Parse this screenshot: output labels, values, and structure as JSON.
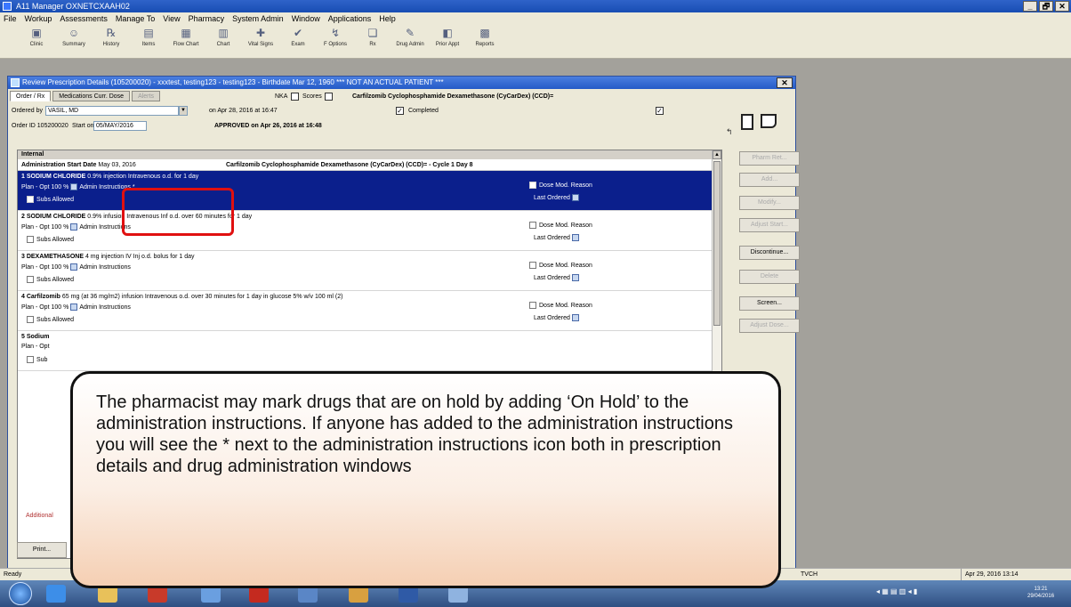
{
  "app": {
    "title": "A11 Manager OXNETCXAAH02",
    "controls": [
      "_",
      "🗗",
      "✕"
    ]
  },
  "menu": [
    "File",
    "Workup",
    "Assessments",
    "Manage To",
    "View",
    "Pharmacy",
    "System Admin",
    "Window",
    "Applications",
    "Help"
  ],
  "toolbar": [
    {
      "label": "Clinic",
      "icon": "clinic-icon",
      "glyph": "▣"
    },
    {
      "label": "Summary",
      "icon": "summary-icon",
      "glyph": "☺"
    },
    {
      "label": "History",
      "icon": "history-icon",
      "glyph": "℞"
    },
    {
      "label": "Items",
      "icon": "items-icon",
      "glyph": "▤"
    },
    {
      "label": "Flow Chart",
      "icon": "flow-chart-icon",
      "glyph": "▦"
    },
    {
      "label": "Chart",
      "icon": "chart-icon",
      "glyph": "▥"
    },
    {
      "label": "Vital Signs",
      "icon": "vital-signs-icon",
      "glyph": "✚"
    },
    {
      "label": "Exam",
      "icon": "exam-icon",
      "glyph": "✔"
    },
    {
      "label": "F Options",
      "icon": "options-icon",
      "glyph": "↯"
    },
    {
      "label": "Rx",
      "icon": "rx-icon",
      "glyph": "❏"
    },
    {
      "label": "Drug Admin",
      "icon": "drug-admin-icon",
      "glyph": "✎"
    },
    {
      "label": "Prior Appt",
      "icon": "prior-appt-icon",
      "glyph": "◧"
    },
    {
      "label": "Reports",
      "icon": "reports-icon",
      "glyph": "▩"
    }
  ],
  "child": {
    "title": "Review Prescription Details (105200020) - xxxtest, testing123 - testing123 - Birthdate Mar 12, 1960 *** NOT AN ACTUAL PATIENT ***",
    "close": "✕",
    "tabs": [
      "Order / Rx",
      "Medications Curr. Dose",
      "Alerts"
    ],
    "nka": "NKA",
    "scores": "Scores",
    "regimen_title": "Carfilzomib Cyclophosphamide Dexamethasone (CyCarDex) (CCD)=",
    "ordered_by_label": "Ordered by",
    "ordered_by_value": "VASIL, MD",
    "ordered_on": "on Apr 28, 2016  at 16:47",
    "completed_label": "Completed",
    "order_id_label": "Order ID 105200020",
    "start_on_label": "Start on",
    "start_on_value": "05/MAY/2016",
    "approved": "APPROVED on Apr 26, 2016 at 16:48",
    "section": "Internal",
    "admin_start_label": "Administration Start Date",
    "admin_start_value": "May 03, 2016",
    "protocol_line": "Carfilzomib Cyclophosphamide Dexamethasone (CyCarDex) (CCD)= - Cycle 1 Day 8"
  },
  "drugs": [
    {
      "name": "1  SODIUM CHLORIDE",
      "detail": "0.9% injection Intravenous o.d. for 1 day",
      "plan": "Plan - Opt   100 %",
      "admin": "Admin Instructions",
      "admin_star": "*",
      "subs": "Subs Allowed",
      "dose_mod": "Dose Mod. Reason",
      "last_ordered": "Last Ordered"
    },
    {
      "name": "2  SODIUM CHLORIDE",
      "detail": "0.9% infusion Intravenous Inf o.d. over 60 minutes for 1 day",
      "plan": "Plan - Opt   100 %",
      "admin": "Admin Instructions",
      "subs": "Subs Allowed",
      "dose_mod": "Dose Mod. Reason",
      "last_ordered": "Last Ordered"
    },
    {
      "name": "3  DEXAMETHASONE",
      "detail": "4 mg injection IV Inj o.d. bolus for 1 day",
      "plan": "Plan - Opt   100 %",
      "admin": "Admin Instructions",
      "subs": "Subs Allowed",
      "dose_mod": "Dose Mod. Reason",
      "last_ordered": "Last Ordered"
    },
    {
      "name": "4  Carfilzomib",
      "detail": "65 mg (at 36 mg/m2) infusion Intravenous o.d. over 30 minutes for 1 day in glucose 5% w/v 100 ml (2)",
      "plan": "Plan - Opt   100 %",
      "admin": "Admin Instructions",
      "subs": "Subs Allowed",
      "dose_mod": "Dose Mod. Reason",
      "last_ordered": "Last Ordered"
    },
    {
      "name": "5  Sodium",
      "detail": "",
      "plan": "Plan - Opt",
      "admin": "",
      "subs": "Sub",
      "dose_mod": "",
      "last_ordered": ""
    }
  ],
  "side_buttons": [
    {
      "label": "Pharm Ret...",
      "enabled": false
    },
    {
      "label": "Add...",
      "enabled": false
    },
    {
      "label": "Modify...",
      "enabled": false
    },
    {
      "label": "Adjust Start...",
      "enabled": false
    },
    {
      "label": "Discontinue...",
      "enabled": true
    },
    {
      "label": "Delete",
      "enabled": false
    },
    {
      "label": "Screen...",
      "enabled": true
    },
    {
      "label": "Adjust Dose...",
      "enabled": false
    }
  ],
  "bottom": {
    "print": "Print...",
    "additional": "Additional"
  },
  "status": {
    "left": "Ready",
    "user": "TVCH",
    "date": "Apr 29, 2016 13:14"
  },
  "taskbar": {
    "clock_time": "13:21",
    "clock_date": "29/04/2016"
  },
  "callout": {
    "text": "The pharmacist may mark drugs that are on hold by adding ‘On Hold’ to the administration instructions. If anyone has added to the administration instructions you will see the * next to the administration instructions icon both in prescription details and drug administration windows"
  },
  "colors": {
    "titlebar": "#184db3",
    "selected_row": "#0b1f8c",
    "highlight": "#e01010",
    "callout_bottom": "#f5cfb3"
  }
}
